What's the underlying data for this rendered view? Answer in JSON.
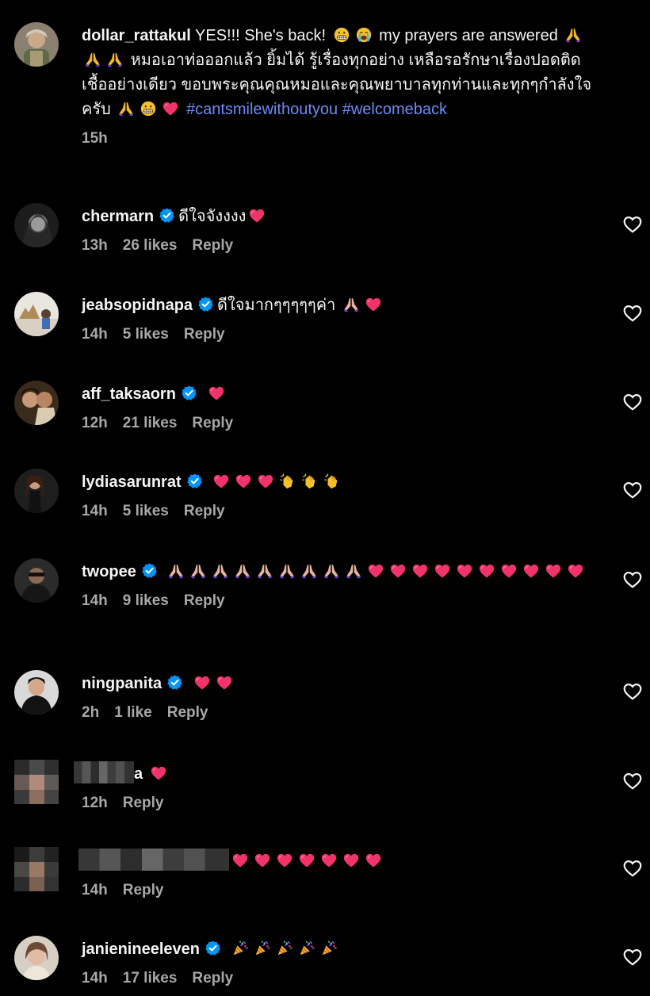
{
  "comments": [
    {
      "username": "dollar_rattakul",
      "verified": false,
      "text_part1": "YES!!! She's back!",
      "text_part2": "my prayers are answered",
      "text_part3": "หมอเอาท่อออกแล้ว ยิ้มได้ รู้เรื่องทุกอย่าง เหลือรอรักษาเรื่องปอดติดเชื้ออย่างเดียว ขอบพระคุณคุณหมอและคุณพยาบาลทุกท่านและทุกๆกำลังใจครับ",
      "hashtag1": "#cantsmilewithoutyou",
      "hashtag2": "#welcomeback",
      "time": "15h"
    },
    {
      "username": "chermarn",
      "verified": true,
      "text": "ดีใจจังงงง",
      "time": "13h",
      "likes": "26 likes",
      "reply": "Reply"
    },
    {
      "username": "jeabsopidnapa",
      "verified": true,
      "text": "ดีใจมากๆๆๆๆๆค่า",
      "time": "14h",
      "likes": "5 likes",
      "reply": "Reply"
    },
    {
      "username": "aff_taksaorn",
      "verified": true,
      "time": "12h",
      "likes": "21 likes",
      "reply": "Reply"
    },
    {
      "username": "lydiasarunrat",
      "verified": true,
      "time": "14h",
      "likes": "5 likes",
      "reply": "Reply"
    },
    {
      "username": "twopee",
      "verified": true,
      "time": "14h",
      "likes": "9 likes",
      "reply": "Reply"
    },
    {
      "username": "ningpanita",
      "verified": true,
      "time": "2h",
      "likes": "1 like",
      "reply": "Reply"
    },
    {
      "username_visible_part": "a",
      "verified": false,
      "time": "12h",
      "reply": "Reply"
    },
    {
      "verified": false,
      "time": "14h",
      "reply": "Reply"
    },
    {
      "username": "janienineeleven",
      "verified": true,
      "time": "14h",
      "likes": "17 likes",
      "reply": "Reply"
    }
  ],
  "colors": {
    "background": "#000000",
    "text": "#f5f5f5",
    "meta": "#a8a8a8",
    "hashtag": "#6f8bf5",
    "verified_badge": "#0095f6",
    "heart_emoji": "#f0336a"
  },
  "icons": {
    "verified": "verified-badge-icon",
    "like": "heart-outline-icon",
    "emoji_heart": "red-heart-emoji",
    "emoji_pray": "folded-hands-emoji",
    "emoji_clap": "clapping-hands-emoji",
    "emoji_party": "party-popper-emoji",
    "emoji_grimace": "grimacing-face-emoji",
    "emoji_cry": "crying-face-emoji"
  }
}
